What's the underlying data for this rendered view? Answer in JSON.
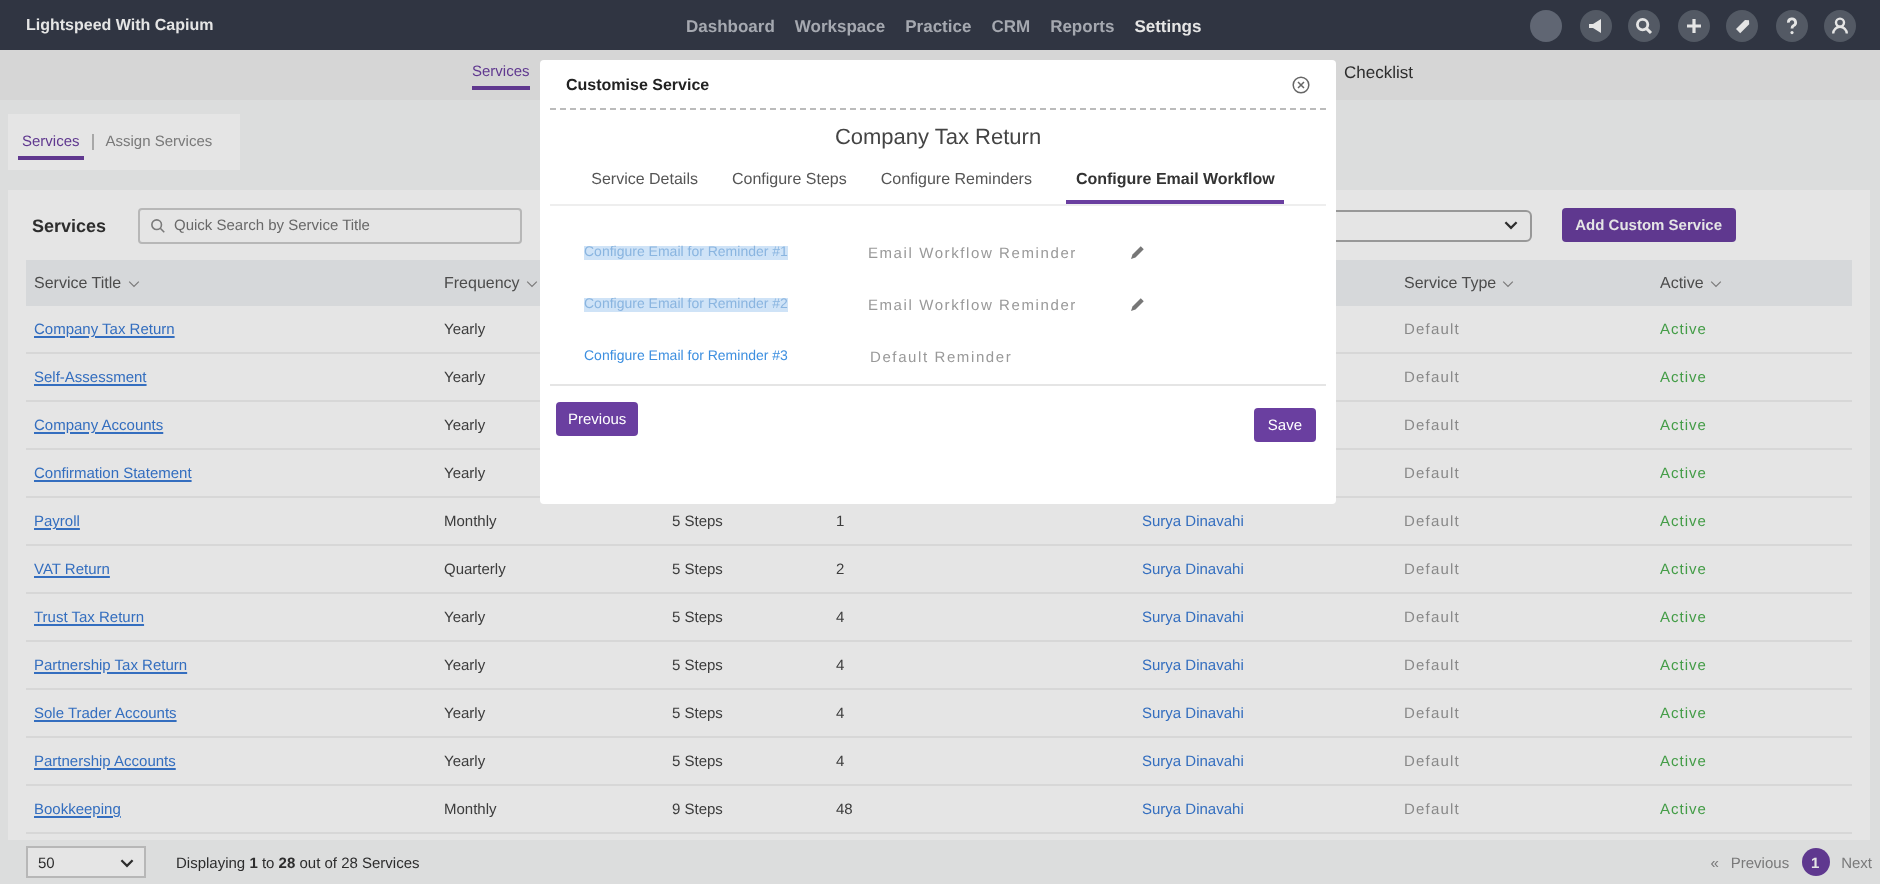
{
  "app": {
    "brand": "Lightspeed With Capium",
    "nav": [
      {
        "label": "Dashboard",
        "selected": false
      },
      {
        "label": "Workspace",
        "selected": false
      },
      {
        "label": "Practice",
        "selected": false
      },
      {
        "label": "CRM",
        "selected": false
      },
      {
        "label": "Reports",
        "selected": false
      },
      {
        "label": "Settings",
        "selected": true
      }
    ]
  },
  "subnav": {
    "tabs": [
      {
        "label": "Services",
        "selected": true
      },
      {
        "label": "Checklist",
        "selected": false
      }
    ]
  },
  "service_tabs": [
    {
      "label": "Services",
      "selected": true
    },
    {
      "label": "Assign Services",
      "selected": false
    }
  ],
  "services": {
    "title": "Services",
    "search": {
      "placeholder": "Quick Search by Service Title"
    },
    "add_button": "Add Custom Service",
    "columns": [
      {
        "label": "Service Title"
      },
      {
        "label": "Frequency"
      },
      {
        "label": "Service Type"
      },
      {
        "label": "Active"
      }
    ],
    "rows": [
      {
        "title": "Company Tax Return",
        "frequency": "Yearly",
        "service_type": "Default",
        "status": "Active"
      },
      {
        "title": "Self-Assessment",
        "frequency": "Yearly",
        "service_type": "Default",
        "status": "Active"
      },
      {
        "title": "Company Accounts",
        "frequency": "Yearly",
        "service_type": "Default",
        "status": "Active"
      },
      {
        "title": "Confirmation Statement",
        "frequency": "Yearly",
        "service_type": "Default",
        "status": "Active"
      },
      {
        "title": "Payroll",
        "frequency": "Monthly",
        "column_3": "5 Steps",
        "column_4": "1",
        "column_5": "Surya Dinavahi",
        "service_type": "Default",
        "status": "Active"
      },
      {
        "title": "VAT Return",
        "frequency": "Quarterly",
        "column_3": "5 Steps",
        "column_4": "2",
        "column_5": "Surya Dinavahi",
        "service_type": "Default",
        "status": "Active"
      },
      {
        "title": "Trust Tax Return",
        "frequency": "Yearly",
        "column_3": "5 Steps",
        "column_4": "4",
        "column_5": "Surya Dinavahi",
        "service_type": "Default",
        "status": "Active"
      },
      {
        "title": "Partnership Tax Return",
        "frequency": "Yearly",
        "column_3": "5 Steps",
        "column_4": "4",
        "column_5": "Surya Dinavahi",
        "service_type": "Default",
        "status": "Active"
      },
      {
        "title": "Sole Trader Accounts",
        "frequency": "Yearly",
        "column_3": "5 Steps",
        "column_4": "4",
        "column_5": "Surya Dinavahi",
        "service_type": "Default",
        "status": "Active"
      },
      {
        "title": "Partnership Accounts",
        "frequency": "Yearly",
        "column_3": "5 Steps",
        "column_4": "4",
        "column_5": "Surya Dinavahi",
        "service_type": "Default",
        "status": "Active"
      },
      {
        "title": "Bookkeeping",
        "frequency": "Monthly",
        "column_3": "9 Steps",
        "column_4": "48",
        "column_5": "Surya Dinavahi",
        "service_type": "Default",
        "status": "Active"
      }
    ]
  },
  "footer": {
    "page_size": "50",
    "summary": "Displaying **1** to **28** out of 28 Services",
    "pagination": {
      "first": "«",
      "previous": "Previous",
      "pages": [
        {
          "label": "1",
          "selected": true
        }
      ],
      "next": "Next"
    }
  },
  "modal": {
    "title": "Customise Service",
    "service_name": "Company Tax Return",
    "tabs": [
      {
        "label": "Service Details",
        "selected": false
      },
      {
        "label": "Configure Steps",
        "selected": false
      },
      {
        "label": "Configure Reminders",
        "selected": false
      },
      {
        "label": "Configure Email Workflow",
        "selected": true
      }
    ],
    "reminders": [
      {
        "link": "Configure Email for Reminder #1",
        "type": "Email Workflow Reminder",
        "highlighted": true,
        "editable": true
      },
      {
        "link": "Configure Email for Reminder #2",
        "type": "Email Workflow Reminder",
        "highlighted": true,
        "editable": true
      },
      {
        "link": "Configure Email for Reminder #3",
        "type": "Default Reminder",
        "highlighted": false,
        "editable": false
      }
    ],
    "previous_button": "Previous",
    "save_button": "Save"
  }
}
